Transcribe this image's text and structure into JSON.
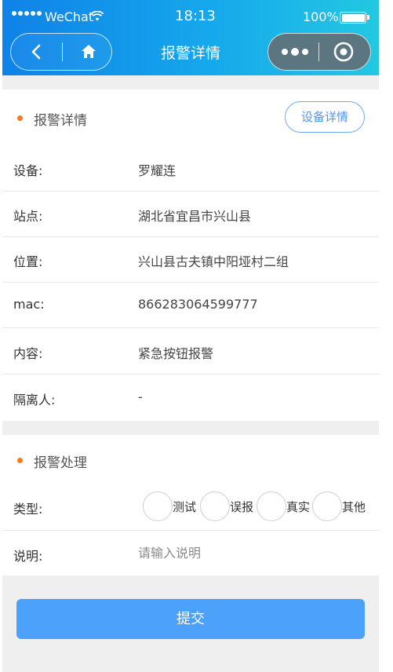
{
  "status_bar": {
    "carrier": "WeChat",
    "time": "18:13",
    "battery": "100%",
    "battery_level": 1.0
  },
  "nav": {
    "title": "报警详情",
    "icons": {
      "back": "chevron-left-icon",
      "home": "home-icon",
      "more": "more-dots-icon",
      "close": "target-circle-icon"
    }
  },
  "alarm_detail": {
    "title": "报警详情",
    "device_button": "设备详情",
    "rows": [
      {
        "label": "设备:",
        "value": "罗耀连"
      },
      {
        "label": "站点:",
        "value": "湖北省宜昌市兴山县"
      },
      {
        "label": "位置:",
        "value": "兴山县古夫镇中阳垭村二组"
      },
      {
        "label": "mac:",
        "value": "866283064599777"
      },
      {
        "label": "内容:",
        "value": "紧急按钮报警"
      },
      {
        "label": "隔离人:",
        "value": "-"
      }
    ]
  },
  "alarm_handle": {
    "title": "报警处理",
    "type_label": "类型:",
    "type_options": [
      "测试",
      "误报",
      "真实",
      "其他"
    ],
    "desc_label": "说明:",
    "desc_placeholder": "请输入说明",
    "desc_value": ""
  },
  "submit_label": "提交",
  "colors": {
    "header_start": "#0e82e8",
    "header_end": "#22c8e2",
    "accent_dot": "#ef7b25",
    "primary_button": "#4ca2fa",
    "link_blue": "#4f95ee"
  }
}
